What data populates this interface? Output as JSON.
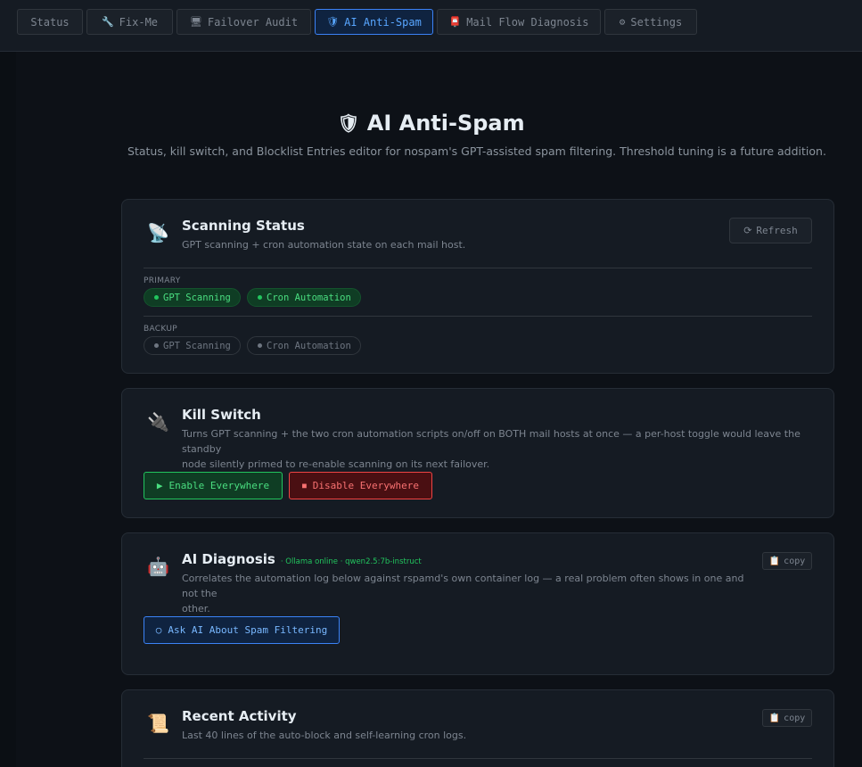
{
  "tabs": [
    {
      "icon": "",
      "label": "Status",
      "active": false
    },
    {
      "icon": "🔧",
      "label": "Fix-Me",
      "active": false
    },
    {
      "icon": "🖥",
      "label": "Failover Audit",
      "active": false
    },
    {
      "icon": "🛡",
      "label": "AI Anti-Spam",
      "active": true
    },
    {
      "icon": "📮",
      "label": "Mail Flow Diagnosis",
      "active": false
    },
    {
      "icon": "⚙",
      "label": "Settings",
      "active": false
    }
  ],
  "page": {
    "icon": "🛡",
    "title": "AI Anti-Spam",
    "subtitle": "Status, kill switch, and Blocklist Entries editor for nospam's GPT-assisted spam filtering. Threshold tuning is a future addition."
  },
  "scanning": {
    "icon": "📡",
    "title": "Scanning Status",
    "desc": "GPT scanning + cron automation state on each mail host.",
    "refresh_icon": "⟳",
    "refresh_label": "Refresh",
    "primary_label": "PRIMARY",
    "primary_gpt": "GPT Scanning",
    "primary_cron": "Cron Automation",
    "backup_label": "BACKUP",
    "backup_gpt": "GPT Scanning",
    "backup_cron": "Cron Automation"
  },
  "kill": {
    "icon": "🔌",
    "title": "Kill Switch",
    "desc_line1": "Turns GPT scanning + the two cron automation scripts on/off on BOTH mail hosts at once — a per-host toggle would leave the standby",
    "desc_line2": "node silently primed to re-enable scanning on its next failover.",
    "enable_icon": "▶",
    "enable_label": "Enable Everywhere",
    "disable_icon": "■",
    "disable_label": "Disable Everywhere"
  },
  "diag": {
    "icon": "🤖",
    "title": "AI Diagnosis",
    "status": "· Ollama online · qwen2.5:7b-instruct",
    "copy_icon": "📋",
    "copy_label": "copy",
    "desc_line1": "Correlates the automation log below against rspamd's own container log — a real problem often shows in one and not the",
    "desc_line2": "other.",
    "ask_icon": "○",
    "ask_label": "Ask AI About Spam Filtering"
  },
  "recent": {
    "icon": "📜",
    "title": "Recent Activity",
    "desc": "Last 40 lines of the auto-block and self-learning cron logs.",
    "copy_icon": "📋",
    "copy_label": "copy"
  },
  "colors": {
    "background": "#0d1117",
    "card": "#151b23",
    "accent_blue": "#3b82f6",
    "green": "#22c55e",
    "red": "#ef4444"
  }
}
